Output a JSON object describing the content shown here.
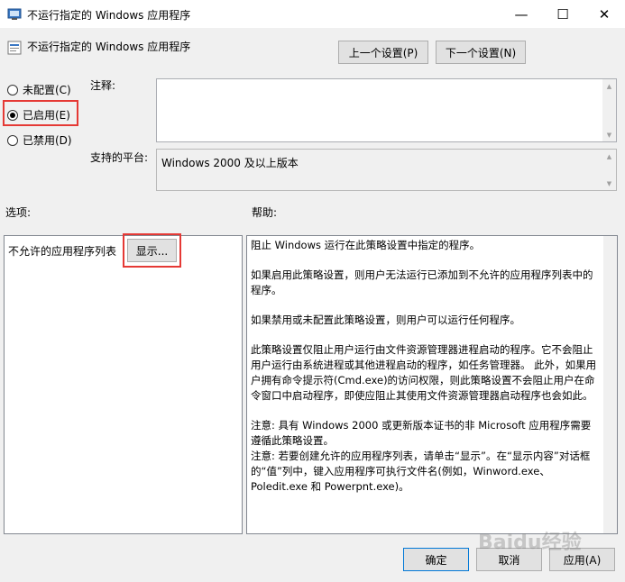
{
  "window": {
    "title": "不运行指定的 Windows 应用程序",
    "minimize": "—",
    "maximize": "☐",
    "close": "✕"
  },
  "header": {
    "policy_name": "不运行指定的 Windows 应用程序",
    "prev_button": "上一个设置(P)",
    "next_button": "下一个设置(N)"
  },
  "state": {
    "options": [
      {
        "label": "未配置(C)",
        "checked": false
      },
      {
        "label": "已启用(E)",
        "checked": true
      },
      {
        "label": "已禁用(D)",
        "checked": false
      }
    ]
  },
  "comment": {
    "label": "注释:",
    "value": ""
  },
  "platform": {
    "label": "支持的平台:",
    "value": "Windows 2000 及以上版本"
  },
  "options_section": {
    "label": "选项:",
    "list_label": "不允许的应用程序列表",
    "show_button": "显示..."
  },
  "help_section": {
    "label": "帮助:",
    "paragraphs": [
      "阻止 Windows 运行在此策略设置中指定的程序。",
      "如果启用此策略设置，则用户无法运行已添加到不允许的应用程序列表中的程序。",
      "如果禁用或未配置此策略设置，则用户可以运行任何程序。",
      "此策略设置仅阻止用户运行由文件资源管理器进程启动的程序。它不会阻止用户运行由系统进程或其他进程启动的程序，如任务管理器。 此外，如果用户拥有命令提示符(Cmd.exe)的访问权限，则此策略设置不会阻止用户在命令窗口中启动程序，即使应阻止其使用文件资源管理器启动程序也会如此。",
      "注意: 具有 Windows 2000 或更新版本证书的非 Microsoft 应用程序需要遵循此策略设置。",
      "注意: 若要创建允许的应用程序列表，请单击“显示”。在“显示内容”对话框的“值”列中，键入应用程序可执行文件名(例如，Winword.exe、Poledit.exe 和 Powerpnt.exe)。"
    ]
  },
  "footer": {
    "ok": "确定",
    "cancel": "取消",
    "apply": "应用(A)"
  },
  "watermark": "Baidu经验"
}
